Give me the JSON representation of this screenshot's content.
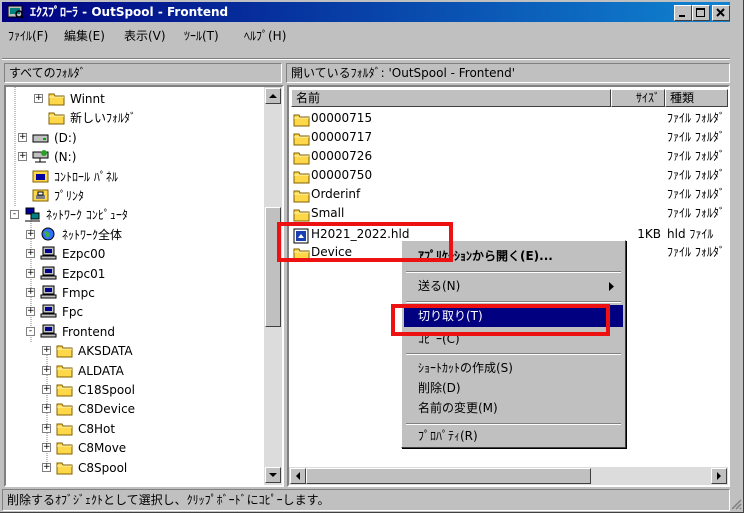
{
  "window": {
    "title": "ｴｸｽﾌﾟﾛｰﾗ - OutSpool - Frontend"
  },
  "menu": [
    "ﾌｧｲﾙ(F)",
    "編集(E)",
    "表示(V)",
    "ﾂｰﾙ(T)",
    "ﾍﾙﾌﾟ(H)"
  ],
  "left_pane": {
    "header": "すべてのﾌｫﾙﾀﾞ",
    "tree": [
      {
        "label": "Winnt",
        "icon": "folder-icon",
        "expander": "+"
      },
      {
        "label": "新しいﾌｫﾙﾀﾞ",
        "icon": "folder-icon",
        "expander": ""
      },
      {
        "label": "(D:)",
        "icon": "drive-icon",
        "expander": "+"
      },
      {
        "label": "(N:)",
        "icon": "network-drive-icon",
        "expander": "+"
      },
      {
        "label": "ｺﾝﾄﾛｰﾙ ﾊﾟﾈﾙ",
        "icon": "control-panel-icon",
        "expander": ""
      },
      {
        "label": "ﾌﾟﾘﾝﾀ",
        "icon": "printer-icon",
        "expander": ""
      },
      {
        "label": "ﾈｯﾄﾜｰｸ ｺﾝﾋﾟｭｰﾀ",
        "icon": "network-icon",
        "expander": "-"
      },
      {
        "label": "ﾈｯﾄﾜｰｸ全体",
        "icon": "globe-icon",
        "expander": "+"
      },
      {
        "label": "Ezpc00",
        "icon": "computer-icon",
        "expander": "+"
      },
      {
        "label": "Ezpc01",
        "icon": "computer-icon",
        "expander": "+"
      },
      {
        "label": "Fmpc",
        "icon": "computer-icon",
        "expander": "+"
      },
      {
        "label": "Fpc",
        "icon": "computer-icon",
        "expander": "+"
      },
      {
        "label": "Frontend",
        "icon": "computer-icon",
        "expander": "-"
      },
      {
        "label": "AKSDATA",
        "icon": "folder-icon",
        "expander": "+"
      },
      {
        "label": "ALDATA",
        "icon": "folder-icon",
        "expander": "+"
      },
      {
        "label": "C18Spool",
        "icon": "folder-icon",
        "expander": "+"
      },
      {
        "label": "C8Device",
        "icon": "folder-icon",
        "expander": "+"
      },
      {
        "label": "C8Hot",
        "icon": "folder-icon",
        "expander": "+"
      },
      {
        "label": "C8Move",
        "icon": "folder-icon",
        "expander": "+"
      },
      {
        "label": "C8Spool",
        "icon": "folder-icon",
        "expander": "+"
      }
    ]
  },
  "right_pane": {
    "header": "開いているﾌｫﾙﾀﾞ: 'OutSpool - Frontend'",
    "columns": {
      "name": "名前",
      "size": "ｻｲｽﾞ",
      "type": "種類"
    },
    "files": [
      {
        "name": "00000715",
        "size": "",
        "type": "ﾌｧｲﾙ ﾌｫﾙﾀﾞ",
        "icon": "folder-icon"
      },
      {
        "name": "00000717",
        "size": "",
        "type": "ﾌｧｲﾙ ﾌｫﾙﾀﾞ",
        "icon": "folder-icon"
      },
      {
        "name": "00000726",
        "size": "",
        "type": "ﾌｧｲﾙ ﾌｫﾙﾀﾞ",
        "icon": "folder-icon"
      },
      {
        "name": "00000750",
        "size": "",
        "type": "ﾌｧｲﾙ ﾌｫﾙﾀﾞ",
        "icon": "folder-icon"
      },
      {
        "name": "Orderinf",
        "size": "",
        "type": "ﾌｧｲﾙ ﾌｫﾙﾀﾞ",
        "icon": "folder-icon"
      },
      {
        "name": "Small",
        "size": "",
        "type": "ﾌｧｲﾙ ﾌｫﾙﾀﾞ",
        "icon": "folder-icon"
      },
      {
        "name": "H2021_2022.hld",
        "size": "1KB",
        "type": "hld ﾌｧｲﾙ",
        "icon": "file-icon"
      },
      {
        "name": "Device",
        "size": "",
        "type": "ﾌｧｲﾙ ﾌｫﾙﾀﾞ",
        "icon": "folder-icon"
      }
    ]
  },
  "context_menu": {
    "items": [
      {
        "label": "ｱﾌﾟﾘｹｰｼｮﾝから開く(E)...",
        "bold": true,
        "submenu": false
      },
      {
        "label": "送る(N)",
        "bold": false,
        "submenu": true
      },
      {
        "label": "切り取り(T)",
        "bold": false,
        "submenu": false,
        "selected": true
      },
      {
        "label": "ｺﾋﾟｰ(C)",
        "bold": false,
        "submenu": false
      },
      {
        "label": "ｼｮｰﾄｶｯﾄの作成(S)",
        "bold": false,
        "submenu": false
      },
      {
        "label": "削除(D)",
        "bold": false,
        "submenu": false
      },
      {
        "label": "名前の変更(M)",
        "bold": false,
        "submenu": false
      },
      {
        "label": "ﾌﾟﾛﾊﾟﾃｨ(R)",
        "bold": false,
        "submenu": false
      }
    ]
  },
  "status": {
    "text": "削除するｵﾌﾞｼﾞｪｸﾄとして選択し、ｸﾘｯﾌﾟﾎﾞｰﾄﾞにｺﾋﾟｰします。"
  },
  "colors": {
    "title_start": "#000080",
    "title_end": "#1084d0",
    "selection": "#000080",
    "highlight_box": "#ee1111",
    "window_bg": "#c0c0c0"
  }
}
